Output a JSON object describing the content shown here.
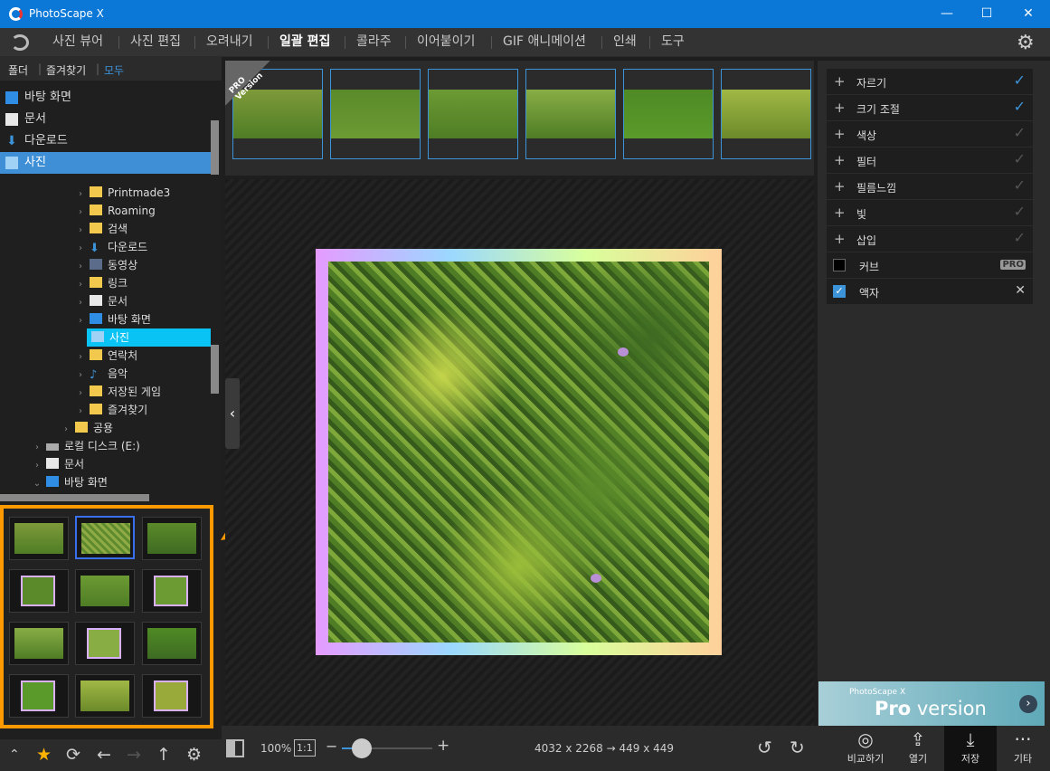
{
  "app": {
    "title": "PhotoScape X",
    "minimize": "—",
    "maximize": "☐",
    "close": "✕"
  },
  "menu": [
    "사진 뷰어",
    "사진 편집",
    "오려내기",
    "일괄 편집",
    "콜라주",
    "이어붙이기",
    "GIF 애니메이션",
    "인쇄",
    "도구"
  ],
  "active_menu": "일괄 편집",
  "left_tabs": [
    "폴더",
    "즐겨찾기",
    "모두"
  ],
  "quick_access": [
    "바탕 화면",
    "문서",
    "다운로드",
    "사진"
  ],
  "tree": [
    "Printmade3",
    "Roaming",
    "검색",
    "다운로드",
    "동영상",
    "링크",
    "문서",
    "바탕 화면",
    "사진",
    "연락처",
    "음악",
    "저장된 게임",
    "즐겨찾기",
    "공용",
    "로컬 디스크 (E:)",
    "문서",
    "바탕 화면"
  ],
  "right_panel": {
    "items": [
      "자르기",
      "크기 조절",
      "색상",
      "필터",
      "필름느낌",
      "빛",
      "삽입"
    ],
    "curve": "커브",
    "curve_badge": "PRO",
    "frame": "액자"
  },
  "bottom": {
    "zoom": "100%",
    "ratio": "1:1",
    "size_info": "4032 x 2268 → 449 x 449"
  },
  "actions": [
    "비교하기",
    "열기",
    "저장",
    "기타"
  ],
  "pro_flag": "PRO Version",
  "pro_banner": {
    "small": "PhotoScape X",
    "pro": "Pro",
    "version": " version"
  },
  "colors": {
    "accent": "#3d93d8",
    "titlebar": "#0b78d7",
    "highlight": "#ff9900",
    "selected_tree": "#08c3f3"
  }
}
